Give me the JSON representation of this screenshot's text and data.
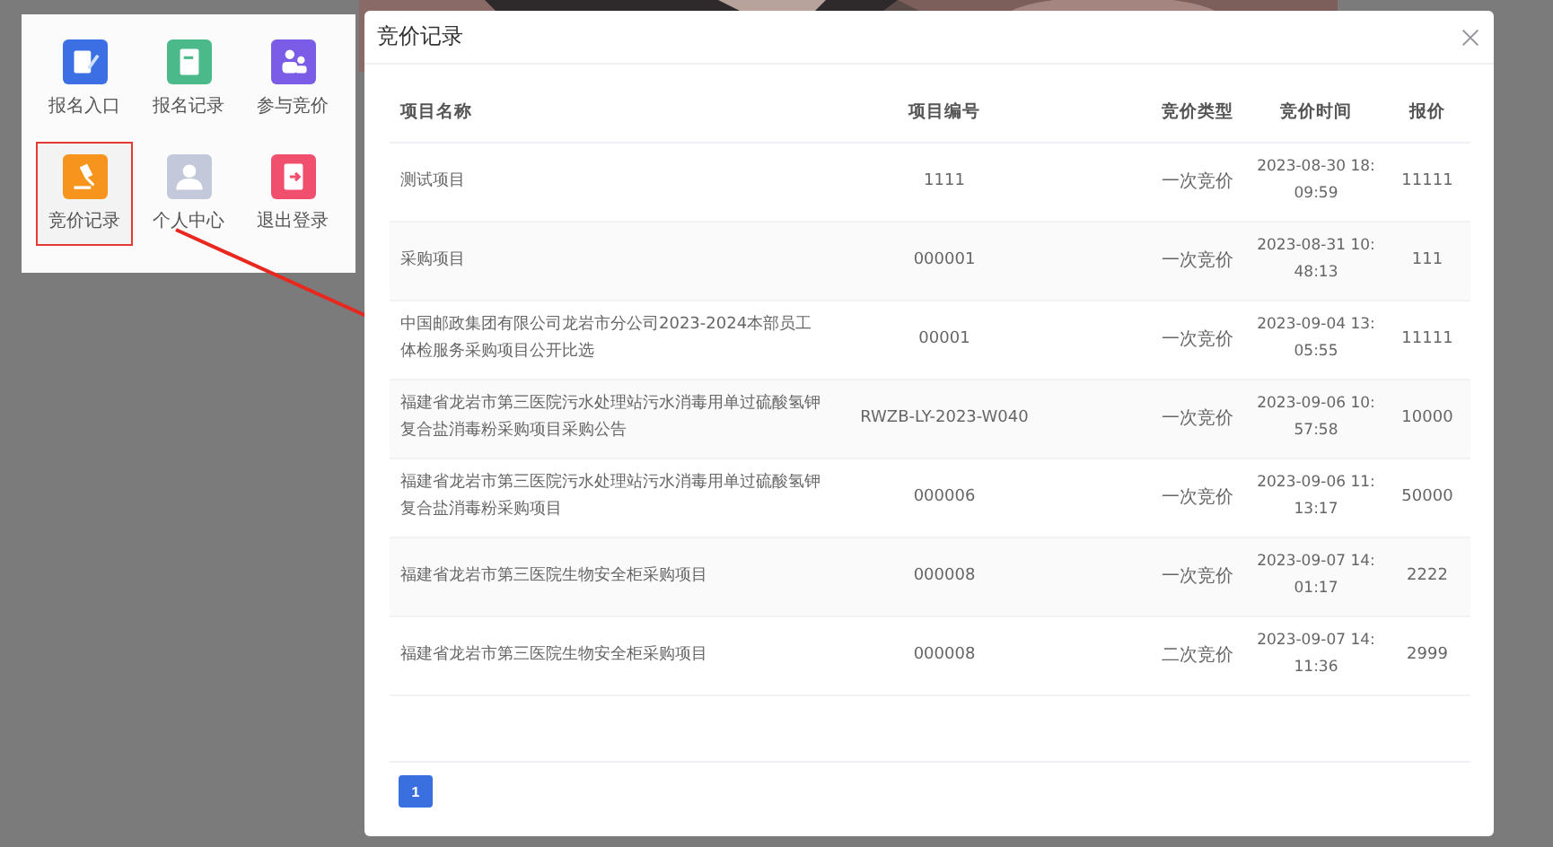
{
  "menu": {
    "items": [
      {
        "label": "报名入口",
        "color": "#3b6fe3",
        "kind": "edit",
        "selected": false
      },
      {
        "label": "报名记录",
        "color": "#4cb98a",
        "kind": "doc",
        "selected": false
      },
      {
        "label": "参与竞价",
        "color": "#7a5ce6",
        "kind": "users",
        "selected": false
      },
      {
        "label": "竞价记录",
        "color": "#f7941d",
        "kind": "gavel",
        "selected": true
      },
      {
        "label": "个人中心",
        "color": "#c3c9da",
        "kind": "user",
        "selected": false
      },
      {
        "label": "退出登录",
        "color": "#f0506e",
        "kind": "exit",
        "selected": false
      }
    ]
  },
  "dialog": {
    "title": "竞价记录",
    "table": {
      "columns": [
        "项目名称",
        "项目编号",
        "竞价类型",
        "竞价时间",
        "报价"
      ],
      "rows": [
        [
          "测试项目",
          "1111",
          "一次竞价",
          "2023-08-30 18:09:59",
          "11111"
        ],
        [
          "采购项目",
          "000001",
          "一次竞价",
          "2023-08-31 10:48:13",
          "111"
        ],
        [
          "中国邮政集团有限公司龙岩市分公司2023-2024本部员工体检服务采购项目公开比选",
          "00001",
          "一次竞价",
          "2023-09-04 13:05:55",
          "11111"
        ],
        [
          "福建省龙岩市第三医院污水处理站污水消毒用单过硫酸氢钾复合盐消毒粉采购项目采购公告",
          "RWZB-LY-2023-W040",
          "一次竞价",
          "2023-09-06 10:57:58",
          "10000"
        ],
        [
          "福建省龙岩市第三医院污水处理站污水消毒用单过硫酸氢钾复合盐消毒粉采购项目",
          "000006",
          "一次竞价",
          "2023-09-06 11:13:17",
          "50000"
        ],
        [
          "福建省龙岩市第三医院生物安全柜采购项目",
          "000008",
          "一次竞价",
          "2023-09-07 14:01:17",
          "2222"
        ],
        [
          "福建省龙岩市第三医院生物安全柜采购项目",
          "000008",
          "二次竞价",
          "2023-09-07 14:11:36",
          "2999"
        ]
      ]
    },
    "pagination": [
      {
        "label": "1",
        "selected": true
      }
    ]
  }
}
